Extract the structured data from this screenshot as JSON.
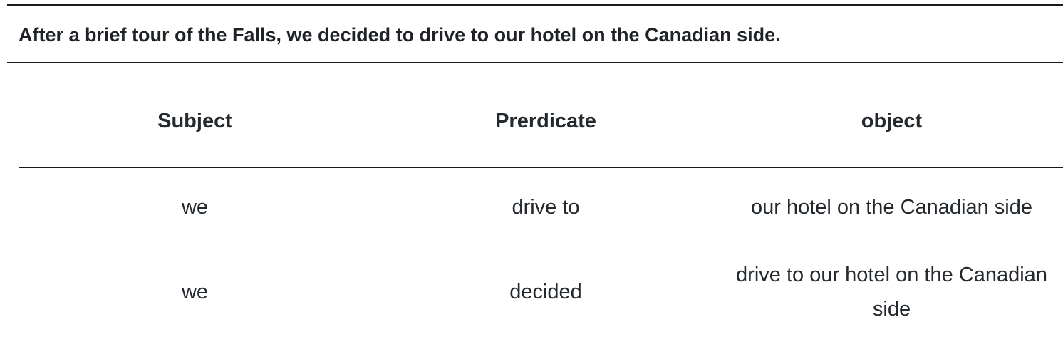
{
  "sentence": "After a brief tour of the Falls, we decided to drive to our hotel on the Canadian side.",
  "table": {
    "headers": [
      "Subject",
      "Prerdicate",
      "object"
    ],
    "rows": [
      [
        "we",
        "drive to",
        "our hotel on the Canadian side"
      ],
      [
        "we",
        "decided",
        "drive to our hotel on the Canadian side"
      ]
    ]
  }
}
